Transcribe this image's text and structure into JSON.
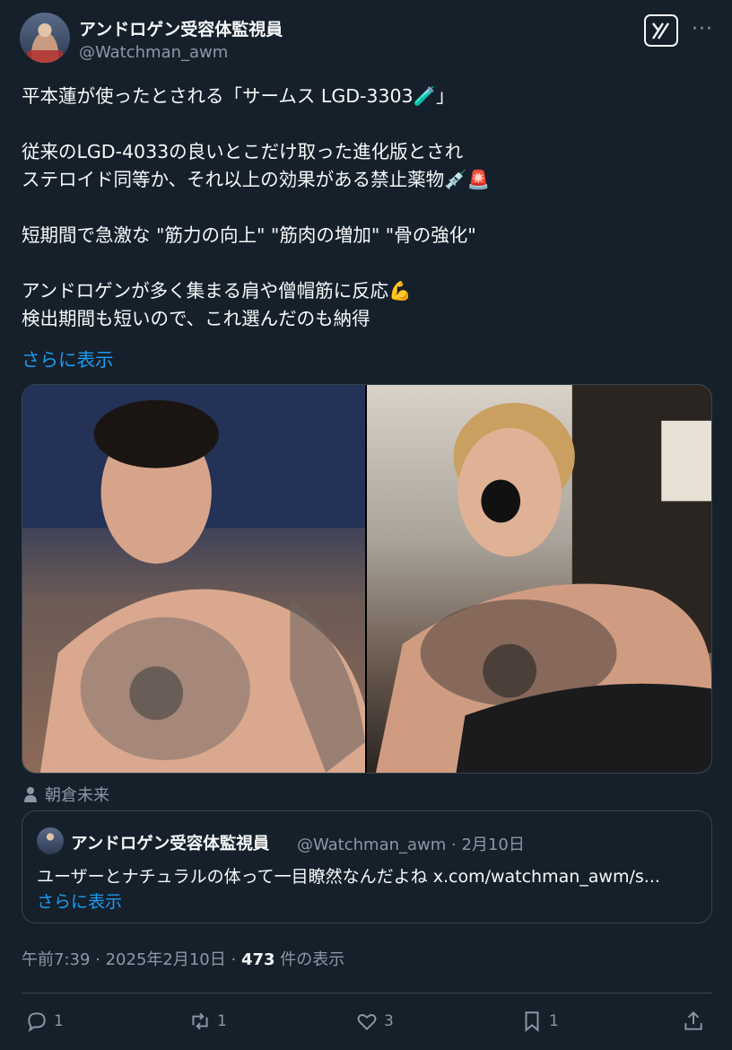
{
  "author": {
    "display_name": "アンドロゲン受容体監視員",
    "handle": "@Watchman_awm"
  },
  "header": {
    "grok_label": "Grok",
    "more_label": "···"
  },
  "tweet": {
    "text": "平本蓮が使ったとされる「サームス LGD-3303🧪」\n\n従来のLGD-4033の良いとこだけ取った進化版とされ\nステロイド同等か、それ以上の効果がある禁止薬物💉🚨\n\n短期間で急激な \"筋力の向上\" \"筋肉の増加\" \"骨の強化\"\n\nアンドロゲンが多く集まる肩や僧帽筋に反応💪\n検出期間も短いので、これ選んだのも納得",
    "show_more": "さらに表示"
  },
  "media": {
    "tagged_person": "朝倉未来"
  },
  "quote": {
    "display_name": "アンドロゲン受容体監視員",
    "handle": "@Watchman_awm",
    "date": "2月10日",
    "text": "ユーザーとナチュラルの体って一目瞭然なんだよね x.com/watchman_awm/s...",
    "show_more": "さらに表示"
  },
  "meta": {
    "time": "午前7:39",
    "date": "2025年2月10日",
    "views_count": "473",
    "views_label": "件の表示"
  },
  "actions": {
    "replies": "1",
    "reposts": "1",
    "likes": "3",
    "bookmarks": "1"
  },
  "colors": {
    "background": "#15202b",
    "text": "#f7f9f9",
    "secondary": "#8b98a5",
    "link": "#1d9bf0",
    "border": "#38444d"
  }
}
